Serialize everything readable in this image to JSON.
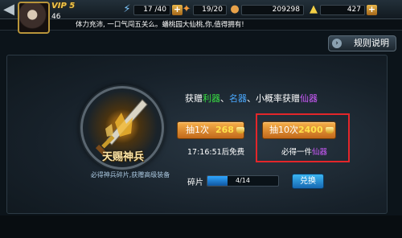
{
  "header": {
    "back_glyph": "◀",
    "vip": "VIP 5",
    "level": "46",
    "stamina": {
      "icon": "stamina-icon",
      "value": "17 /40",
      "plus": "+"
    },
    "energy": {
      "icon": "energy-icon",
      "value": "19/20"
    },
    "coins": {
      "icon": "coin-icon",
      "value": "209298"
    },
    "ingots": {
      "icon": "ingot-icon",
      "value": "427",
      "plus": "+"
    }
  },
  "ticker": {
    "text": "体力充沛, 一口气闯五关么。蟠桃园大仙桃,你,值得拥有!"
  },
  "rules_button": {
    "label": "规则说明",
    "icon": "chevron-right-icon",
    "chevron": "›"
  },
  "emblem": {
    "title": "天赐神兵",
    "subtitle": "必得神兵碎片,获赠高级装备"
  },
  "description": {
    "prefix": "获赠",
    "green": "利器",
    "sep": "、",
    "blue": "名器",
    "mid": "、小概率获赠",
    "purple": "仙器"
  },
  "draw_once": {
    "label": "抽1次",
    "price": "268"
  },
  "draw_ten": {
    "label": "抽10次",
    "price": "2400"
  },
  "free_timer": "17:16:51后免费",
  "guarantee": {
    "prefix": "必得一件",
    "highlight": "仙器"
  },
  "fragments": {
    "label": "碎片",
    "text": "4/14",
    "current": 4,
    "total": 14
  },
  "swap_button": {
    "label": "兑换"
  },
  "colors": {
    "accent_gold": "#f6b04b",
    "green": "#39e043",
    "blue": "#4aa9ff",
    "purple": "#d05bff",
    "highlight_red": "#e3262a"
  }
}
